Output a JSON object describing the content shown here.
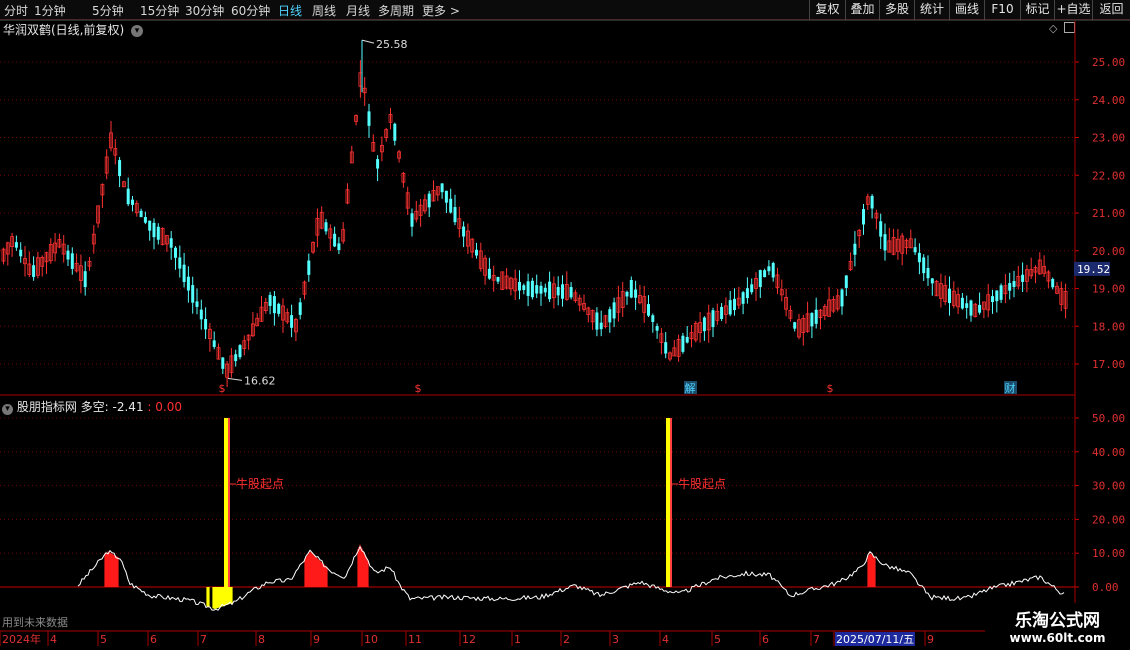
{
  "toolbar": {
    "periods": [
      "分时",
      "1分钟",
      "5分钟",
      "15分钟",
      "30分钟",
      "60分钟",
      "日线",
      "周线",
      "月线",
      "多周期"
    ],
    "more": "更多",
    "buttons": [
      "复权",
      "叠加",
      "多股",
      "统计",
      "画线",
      "F10",
      "标记",
      "+自选",
      "返回"
    ]
  },
  "chart": {
    "title": "华润双鹤(日线,前复权)",
    "price_axis": [
      "25.00",
      "24.00",
      "23.00",
      "22.00",
      "21.00",
      "20.00",
      "19.00",
      "18.00",
      "17.00"
    ],
    "current_price": "19.52",
    "high_label": "25.58",
    "low_label": "16.62",
    "event_markers": [
      {
        "label": "$",
        "color": "#ff3333"
      },
      {
        "label": "$",
        "color": "#ff3333"
      },
      {
        "label": "解",
        "color": "#4fd3ff"
      },
      {
        "label": "$",
        "color": "#ff3333"
      },
      {
        "label": "财",
        "color": "#4fd3ff"
      }
    ]
  },
  "indicator": {
    "name": "股朋指标网",
    "value_label": "多空: -2.41",
    "value2": ": 0.00",
    "axis": [
      "50.00",
      "40.00",
      "30.00",
      "20.00",
      "10.00",
      "0.00"
    ],
    "signal_label": "牛股起点",
    "hint": "用到未来数据"
  },
  "date_axis": {
    "labels": [
      "2024年",
      "4",
      "5",
      "6",
      "7",
      "8",
      "9",
      "10",
      "11",
      "12",
      "1",
      "2",
      "3",
      "4",
      "5",
      "6",
      "7",
      "2025/07/11/五",
      "9"
    ],
    "highlight": "2025/07/11/五"
  },
  "watermark": {
    "line1": "乐淘公式网",
    "line2": "www.60lt.com"
  },
  "colors": {
    "up": "#ff3232",
    "down": "#54ffff",
    "grid": "#7a0000",
    "curve": "#ffffff",
    "signal": "#ffff00"
  },
  "chart_data": {
    "type": "candlestick",
    "ylim": [
      16.5,
      26.0
    ],
    "keypoints": [
      [
        0,
        19.8
      ],
      [
        12,
        20.3
      ],
      [
        30,
        19.4
      ],
      [
        58,
        20.2
      ],
      [
        85,
        19.2
      ],
      [
        110,
        23.0
      ],
      [
        125,
        21.5
      ],
      [
        150,
        20.6
      ],
      [
        170,
        20.2
      ],
      [
        200,
        18.3
      ],
      [
        225,
        16.8
      ],
      [
        245,
        17.6
      ],
      [
        268,
        18.7
      ],
      [
        295,
        18.0
      ],
      [
        318,
        20.9
      ],
      [
        340,
        20.0
      ],
      [
        360,
        24.8
      ],
      [
        375,
        22.2
      ],
      [
        390,
        23.6
      ],
      [
        410,
        20.8
      ],
      [
        440,
        21.7
      ],
      [
        460,
        20.6
      ],
      [
        490,
        19.3
      ],
      [
        525,
        19.0
      ],
      [
        570,
        18.9
      ],
      [
        600,
        18.0
      ],
      [
        630,
        19.0
      ],
      [
        648,
        18.4
      ],
      [
        668,
        17.2
      ],
      [
        700,
        18.0
      ],
      [
        740,
        18.7
      ],
      [
        770,
        19.6
      ],
      [
        795,
        17.9
      ],
      [
        840,
        18.7
      ],
      [
        868,
        21.5
      ],
      [
        885,
        20.1
      ],
      [
        910,
        20.2
      ],
      [
        935,
        19.0
      ],
      [
        975,
        18.4
      ],
      [
        1000,
        18.9
      ],
      [
        1040,
        19.6
      ],
      [
        1062,
        18.7
      ]
    ],
    "indicator_curve": [
      [
        78,
        0.5
      ],
      [
        108,
        10.5
      ],
      [
        120,
        8.5
      ],
      [
        130,
        1.0
      ],
      [
        150,
        -2.5
      ],
      [
        190,
        -4.0
      ],
      [
        215,
        -6.5
      ],
      [
        235,
        -4.5
      ],
      [
        250,
        -1.5
      ],
      [
        268,
        1.5
      ],
      [
        290,
        2.0
      ],
      [
        310,
        10.5
      ],
      [
        330,
        5.0
      ],
      [
        345,
        3.0
      ],
      [
        360,
        12.5
      ],
      [
        375,
        4.0
      ],
      [
        390,
        6.0
      ],
      [
        400,
        0.5
      ],
      [
        410,
        -3.5
      ],
      [
        450,
        -3.0
      ],
      [
        500,
        -3.5
      ],
      [
        540,
        -3.0
      ],
      [
        575,
        0.5
      ],
      [
        600,
        -2.5
      ],
      [
        640,
        1.5
      ],
      [
        660,
        -0.5
      ],
      [
        680,
        -2.0
      ],
      [
        715,
        2.5
      ],
      [
        745,
        4.0
      ],
      [
        770,
        3.5
      ],
      [
        790,
        -2.5
      ],
      [
        840,
        1.5
      ],
      [
        860,
        5.5
      ],
      [
        870,
        10.0
      ],
      [
        885,
        6.5
      ],
      [
        910,
        4.0
      ],
      [
        930,
        -3.0
      ],
      [
        965,
        -3.5
      ],
      [
        990,
        -0.5
      ],
      [
        1040,
        3.0
      ],
      [
        1065,
        -2.5
      ]
    ],
    "indicator_ylim": [
      -11,
      54
    ],
    "red_bars": [
      [
        105,
        118
      ],
      [
        305,
        327
      ],
      [
        358,
        368
      ],
      [
        868,
        875
      ]
    ],
    "yellow_bars": [
      {
        "x": 224,
        "value": 50
      },
      {
        "x": 666,
        "value": 50
      }
    ],
    "yellow_negative": [
      [
        207,
        209
      ],
      [
        213,
        232
      ]
    ]
  }
}
